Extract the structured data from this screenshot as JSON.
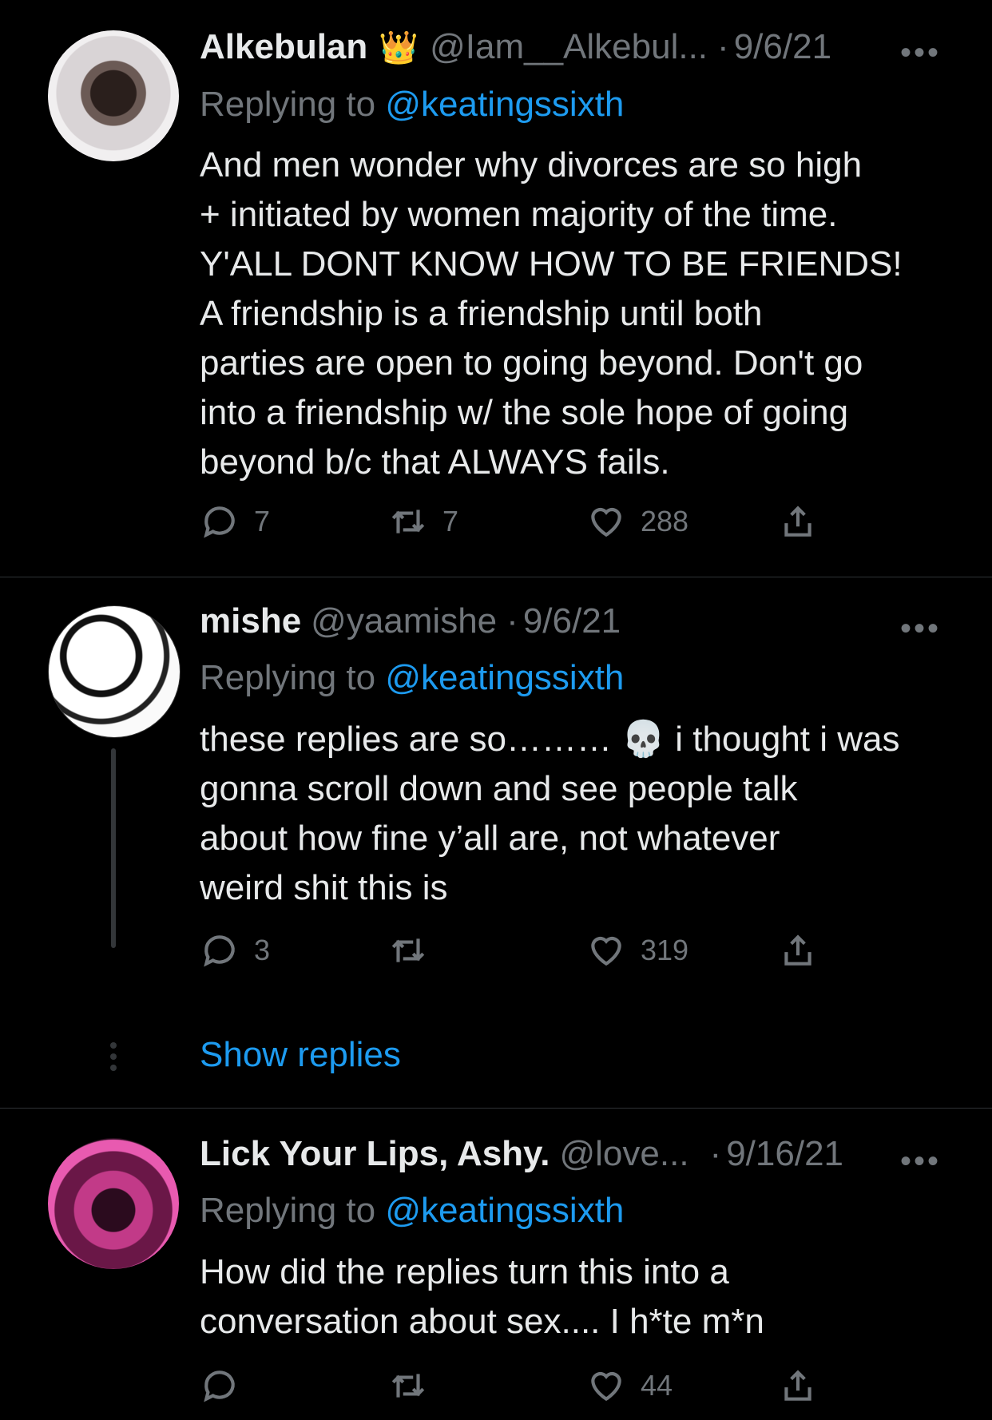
{
  "tweets": [
    {
      "name": "Alkebulan",
      "crown": "👑",
      "handle": "@Iam__Alkebul...",
      "sep": "·",
      "date": "9/6/21",
      "replying_prefix": "Replying to",
      "replying_to": "@keatingssixth",
      "lines": [
        "And men wonder why divorces are so high",
        "+ initiated by women majority of the time.",
        "Y'ALL DONT KNOW HOW TO BE FRIENDS!",
        "A friendship is a friendship until both",
        "parties are open to going beyond. Don't go",
        "into a friendship w/ the sole hope of going",
        "beyond b/c that ALWAYS fails."
      ],
      "replies": "7",
      "retweets": "7",
      "likes": "288"
    },
    {
      "name": "mishe",
      "handle": "@yaamishe",
      "sep": "·",
      "date": "9/6/21",
      "replying_prefix": "Replying to",
      "replying_to": "@keatingssixth",
      "lines": [
        "these replies are so……… 💀 i thought i was",
        "gonna scroll down and see people talk",
        "about how fine y’all are, not whatever",
        "weird shit this is"
      ],
      "replies": "3",
      "retweets": "",
      "likes": "319"
    },
    {
      "name": "Lick Your Lips, Ashy.",
      "handle": "@love...",
      "sep": "·",
      "date": "9/16/21",
      "replying_prefix": "Replying to",
      "replying_to": "@keatingssixth",
      "lines": [
        "How did the replies turn this into a",
        "conversation about sex.... I h*te m*n"
      ],
      "replies": "",
      "retweets": "",
      "likes": "44"
    }
  ],
  "show_replies": "Show replies",
  "more_icon": "•••",
  "icons": {
    "reply": "reply-icon",
    "retweet": "retweet-icon",
    "like": "heart-icon",
    "share": "share-icon"
  },
  "colors": {
    "background": "#000000",
    "link": "#1d9bf0",
    "muted": "#71767b",
    "text": "#e7e9ea"
  }
}
